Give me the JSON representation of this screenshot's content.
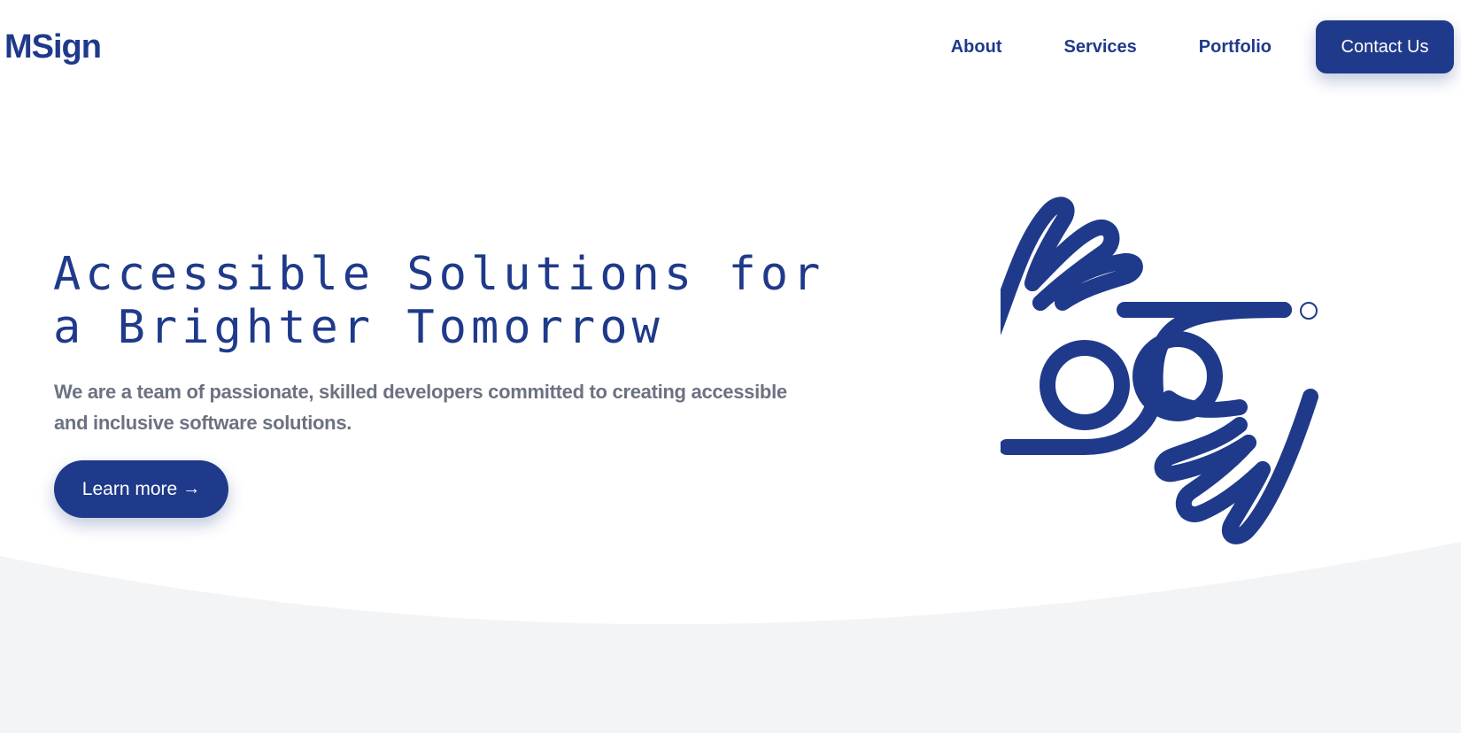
{
  "brand": {
    "logo": "MSign",
    "color": "#1f3a8a"
  },
  "nav": {
    "items": [
      "About",
      "Services",
      "Portfolio"
    ],
    "contact_label": "Contact Us"
  },
  "hero": {
    "title_line1": "Accessible Solutions for",
    "title_line2": "a Brighter Tomorrow",
    "subtitle": "We are a team of passionate, skilled developers committed to creating accessible and inclusive software solutions.",
    "cta_label": "Learn more",
    "cta_icon": "arrow-right-icon",
    "illustration_icon": "sign-language-hands-icon"
  },
  "colors": {
    "accent": "#1f3a8a",
    "text_muted": "#6b7280",
    "bottom_section_bg": "#f3f4f6"
  }
}
